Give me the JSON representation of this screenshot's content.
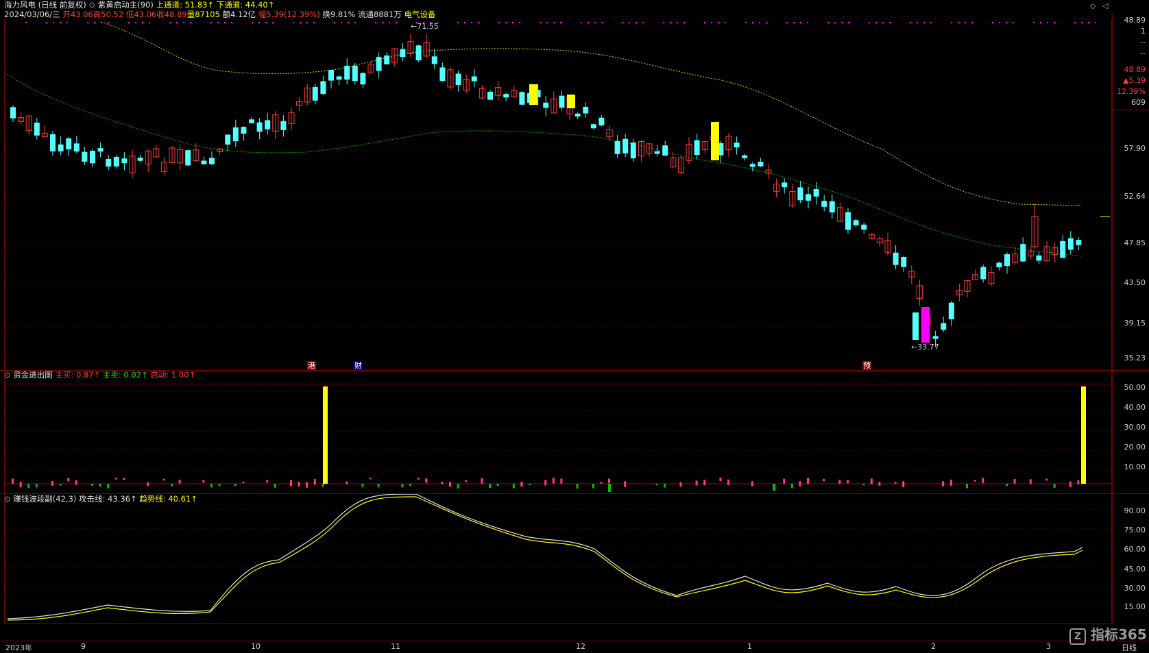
{
  "header": {
    "title": "海力风电 (日线 前复权)",
    "indicator_name": "紫黄启动主(90)",
    "upper_label": "上通道: 51.83↑",
    "lower_label": "下通道: 44.40↑",
    "date": "2024/03/06/三",
    "open": "开43.06",
    "high": "高50.52",
    "low": "低43.06",
    "close": "收48.89",
    "volume": "量87105",
    "amount": "额4.12亿",
    "change": "幅5.39(12.39%)",
    "turnover": "换9.81%",
    "float_shares": "流通8881万",
    "sector": "电气设备"
  },
  "main_axis": {
    "ticks": [
      "57.90",
      "52.64",
      "47.85",
      "43.50",
      "39.15",
      "35.23"
    ],
    "info": [
      "48.89",
      "1",
      "--",
      "--",
      "48.89",
      "▲5.39",
      "12.39%",
      "609"
    ]
  },
  "annotations": {
    "high_label": "71.55",
    "low_label": "33.77"
  },
  "event_badges": [
    "港",
    "财",
    "预"
  ],
  "fund_panel": {
    "title": "资金进出图",
    "main_buy": "主买: 0.87↑",
    "main_sell": "主卖: 0.02↑",
    "start": "启动: 1.00↑",
    "ticks": [
      "50.00",
      "40.00",
      "30.00",
      "20.00",
      "10.00"
    ]
  },
  "wave_panel": {
    "title": "赚钱波段副(42,3)",
    "attack": "攻击线: 43.36↑",
    "trend": "趋势线: 40.61↑",
    "ticks": [
      "90.00",
      "75.00",
      "60.00",
      "45.00",
      "30.00",
      "15.00"
    ]
  },
  "time_axis": {
    "labels": [
      "2023年",
      "9",
      "10",
      "11",
      "12",
      "1",
      "2",
      "3"
    ],
    "period": "日线"
  },
  "watermark": "指标365",
  "colors": {
    "up": "#ff3c3c",
    "down": "#54ffff",
    "yellow": "#ffff00",
    "magenta": "#ff00ff",
    "green": "#00c800",
    "upper_band": "#d8d800",
    "lower_band": "#00b000"
  }
}
